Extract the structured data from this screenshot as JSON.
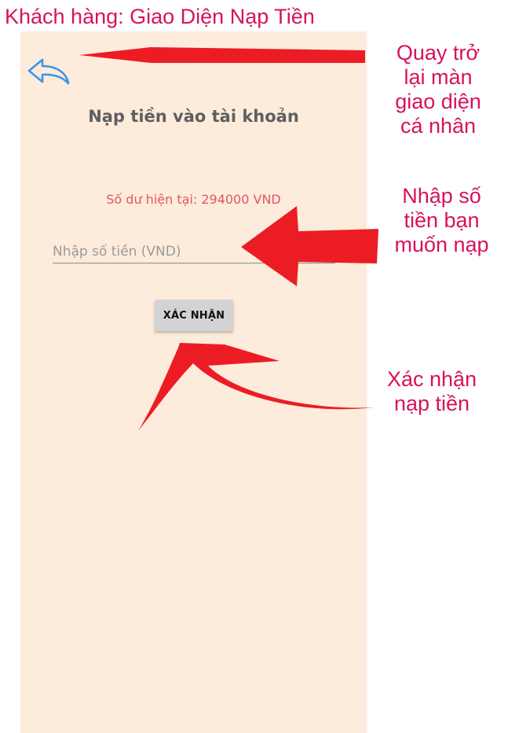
{
  "caption": "Khách hàng: Giao Diện Nạp Tiền",
  "app": {
    "title": "Nạp tiền vào tài khoản",
    "balance": "Số dư hiện tại: 294000 VND",
    "amount_input": {
      "placeholder": "Nhập số tiền (VND)",
      "value": ""
    },
    "confirm_button": "XÁC NHẬN",
    "back_icon": "undo-arrow-icon"
  },
  "annotations": {
    "back": [
      "Quay trở",
      "lại màn",
      "giao diện",
      "cá nhân"
    ],
    "input": [
      "Nhập số",
      "tiền bạn",
      "muốn nạp"
    ],
    "confirm": [
      "Xác nhận",
      "nạp tiền"
    ]
  },
  "colors": {
    "annotation": "#d8125d",
    "arrow": "#ec1c24",
    "phone_background": "#fdebdc",
    "balance_text": "#e2585b",
    "back_icon": "#3b95e6"
  }
}
